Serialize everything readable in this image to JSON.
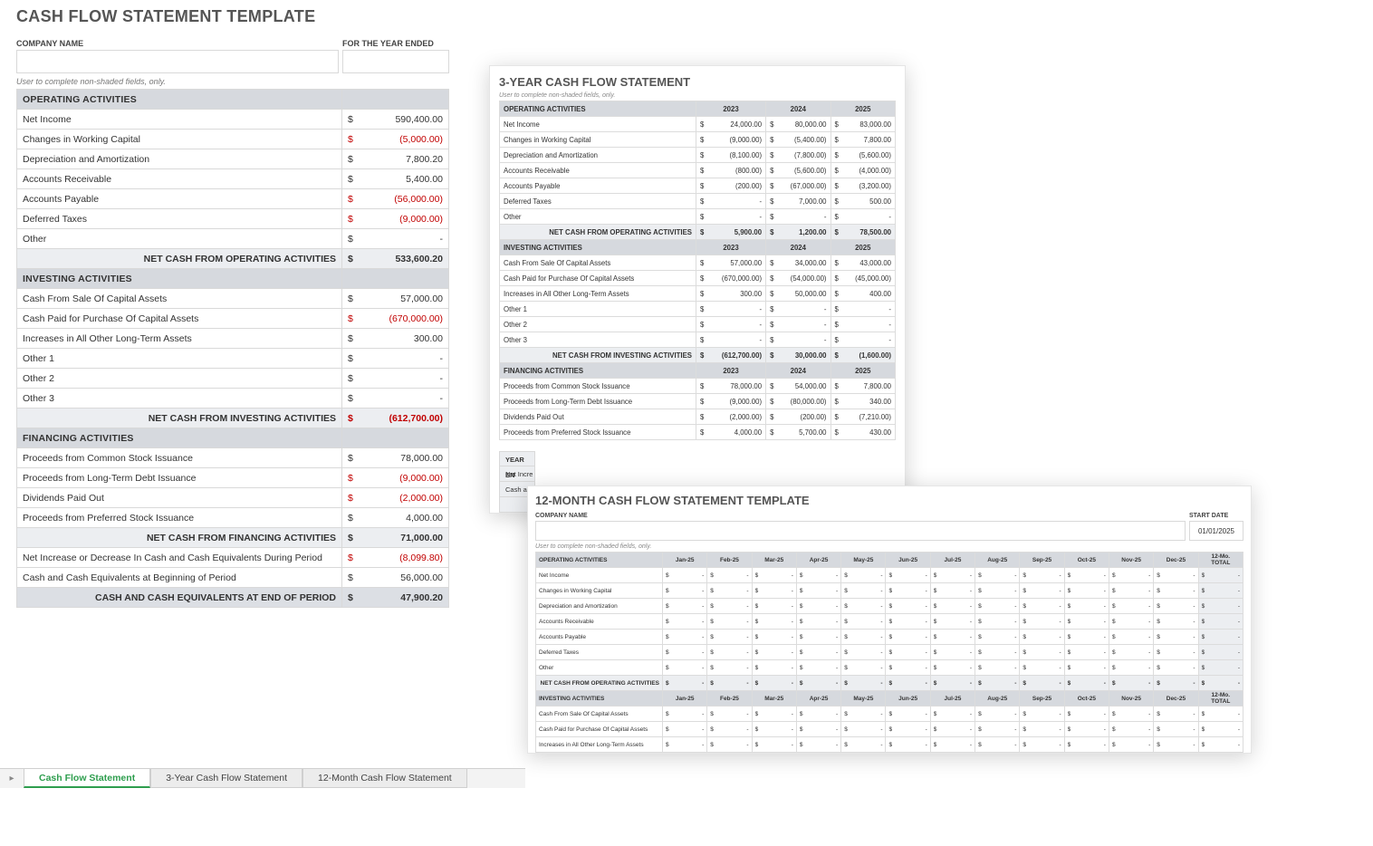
{
  "main": {
    "title": "CASH FLOW STATEMENT TEMPLATE",
    "company_label": "COMPANY NAME",
    "year_ended_label": "FOR THE YEAR ENDED",
    "note": "User to complete non-shaded fields, only.",
    "op_section": "OPERATING ACTIVITIES",
    "op_rows": [
      {
        "label": "Net Income",
        "value": "590,400.00"
      },
      {
        "label": "Changes in Working Capital",
        "value": "(5,000.00)",
        "neg": true
      },
      {
        "label": "Depreciation and Amortization",
        "value": "7,800.20"
      },
      {
        "label": "Accounts Receivable",
        "value": "5,400.00"
      },
      {
        "label": "Accounts Payable",
        "value": "(56,000.00)",
        "neg": true
      },
      {
        "label": "Deferred Taxes",
        "value": "(9,000.00)",
        "neg": true
      },
      {
        "label": "Other",
        "value": "-"
      }
    ],
    "op_total_label": "NET CASH FROM OPERATING ACTIVITIES",
    "op_total": "533,600.20",
    "inv_section": "INVESTING ACTIVITIES",
    "inv_rows": [
      {
        "label": "Cash From Sale Of Capital Assets",
        "value": "57,000.00"
      },
      {
        "label": "Cash Paid for Purchase Of Capital Assets",
        "value": "(670,000.00)",
        "neg": true
      },
      {
        "label": "Increases in All Other Long-Term Assets",
        "value": "300.00"
      },
      {
        "label": "Other 1",
        "value": "-"
      },
      {
        "label": "Other 2",
        "value": "-"
      },
      {
        "label": "Other 3",
        "value": "-"
      }
    ],
    "inv_total_label": "NET CASH FROM INVESTING ACTIVITIES",
    "inv_total": "(612,700.00)",
    "fin_section": "FINANCING ACTIVITIES",
    "fin_rows": [
      {
        "label": "Proceeds from Common Stock Issuance",
        "value": "78,000.00"
      },
      {
        "label": "Proceeds from Long-Term Debt Issuance",
        "value": "(9,000.00)",
        "neg": true
      },
      {
        "label": "Dividends Paid Out",
        "value": "(2,000.00)",
        "neg": true
      },
      {
        "label": "Proceeds from Preferred Stock Issuance",
        "value": "4,000.00"
      }
    ],
    "fin_total_label": "NET CASH FROM FINANCING ACTIVITIES",
    "fin_total": "71,000.00",
    "net_change_label": "Net Increase or Decrease In Cash and Cash Equivalents During Period",
    "net_change": "(8,099.80)",
    "begin_label": "Cash and Cash Equivalents at Beginning of Period",
    "begin": "56,000.00",
    "end_label": "CASH AND CASH EQUIVALENTS AT END OF PERIOD",
    "end": "47,900.20"
  },
  "three_year": {
    "title": "3-YEAR CASH FLOW STATEMENT",
    "note": "User to complete non-shaded fields, only.",
    "years": [
      "2023",
      "2024",
      "2025"
    ],
    "op_section": "OPERATING ACTIVITIES",
    "op_rows": [
      {
        "label": "Net Income",
        "v": [
          "24,000.00",
          "80,000.00",
          "83,000.00"
        ]
      },
      {
        "label": "Changes in Working Capital",
        "v": [
          "(9,000.00)",
          "(5,400.00)",
          "7,800.00"
        ],
        "neg": [
          true,
          true,
          false
        ]
      },
      {
        "label": "Depreciation and Amortization",
        "v": [
          "(8,100.00)",
          "(7,800.00)",
          "(5,600.00)"
        ],
        "neg": [
          true,
          true,
          true
        ]
      },
      {
        "label": "Accounts Receivable",
        "v": [
          "(800.00)",
          "(5,600.00)",
          "(4,000.00)"
        ],
        "neg": [
          true,
          true,
          true
        ]
      },
      {
        "label": "Accounts Payable",
        "v": [
          "(200.00)",
          "(67,000.00)",
          "(3,200.00)"
        ],
        "neg": [
          true,
          true,
          true
        ]
      },
      {
        "label": "Deferred Taxes",
        "v": [
          "-",
          "7,000.00",
          "500.00"
        ]
      },
      {
        "label": "Other",
        "v": [
          "-",
          "-",
          "-"
        ]
      }
    ],
    "op_total_label": "NET CASH FROM OPERATING ACTIVITIES",
    "op_total": [
      "5,900.00",
      "1,200.00",
      "78,500.00"
    ],
    "inv_section": "INVESTING ACTIVITIES",
    "inv_rows": [
      {
        "label": "Cash From Sale Of Capital Assets",
        "v": [
          "57,000.00",
          "34,000.00",
          "43,000.00"
        ]
      },
      {
        "label": "Cash Paid for Purchase Of Capital Assets",
        "v": [
          "(670,000.00)",
          "(54,000.00)",
          "(45,000.00)"
        ],
        "neg": [
          true,
          true,
          true
        ]
      },
      {
        "label": "Increases in All Other Long-Term Assets",
        "v": [
          "300.00",
          "50,000.00",
          "400.00"
        ]
      },
      {
        "label": "Other 1",
        "v": [
          "-",
          "-",
          "-"
        ]
      },
      {
        "label": "Other 2",
        "v": [
          "-",
          "-",
          "-"
        ]
      },
      {
        "label": "Other 3",
        "v": [
          "-",
          "-",
          "-"
        ]
      }
    ],
    "inv_total_label": "NET CASH FROM INVESTING ACTIVITIES",
    "inv_total": [
      "(612,700.00)",
      "30,000.00",
      "(1,600.00)"
    ],
    "inv_total_neg": [
      true,
      false,
      true
    ],
    "fin_section": "FINANCING ACTIVITIES",
    "fin_rows": [
      {
        "label": "Proceeds from Common Stock Issuance",
        "v": [
          "78,000.00",
          "54,000.00",
          "7,800.00"
        ]
      },
      {
        "label": "Proceeds from Long-Term Debt Issuance",
        "v": [
          "(9,000.00)",
          "(80,000.00)",
          "340.00"
        ],
        "neg": [
          true,
          true,
          false
        ]
      },
      {
        "label": "Dividends Paid Out",
        "v": [
          "(2,000.00)",
          "(200.00)",
          "(7,210.00)"
        ],
        "neg": [
          true,
          true,
          true
        ]
      },
      {
        "label": "Proceeds from Preferred Stock Issuance",
        "v": [
          "4,000.00",
          "5,700.00",
          "430.00"
        ]
      }
    ],
    "under_labels": [
      "YEAR EN",
      "Net Incre",
      "Cash an",
      ""
    ]
  },
  "twelve_month": {
    "title": "12-MONTH CASH FLOW STATEMENT TEMPLATE",
    "company_label": "COMPANY NAME",
    "start_label": "START DATE",
    "start_date": "01/01/2025",
    "note": "User to complete non-shaded fields, only.",
    "months": [
      "Jan-25",
      "Feb-25",
      "Mar-25",
      "Apr-25",
      "May-25",
      "Jun-25",
      "Jul-25",
      "Aug-25",
      "Sep-25",
      "Oct-25",
      "Nov-25",
      "Dec-25"
    ],
    "total_label": "12-Mo. TOTAL",
    "op_section": "OPERATING ACTIVITIES",
    "op_labels": [
      "Net Income",
      "Changes in Working Capital",
      "Depreciation and Amortization",
      "Accounts Receivable",
      "Accounts Payable",
      "Deferred Taxes",
      "Other"
    ],
    "op_total_label": "NET CASH FROM OPERATING ACTIVITIES",
    "inv_section": "INVESTING ACTIVITIES",
    "inv_labels": [
      "Cash From Sale Of Capital Assets",
      "Cash Paid for Purchase Of Capital Assets",
      "Increases in All Other Long-Term Assets"
    ]
  },
  "tabs": {
    "t1": "Cash Flow Statement",
    "t2": "3-Year Cash Flow Statement",
    "t3": "12-Month Cash Flow Statement"
  }
}
